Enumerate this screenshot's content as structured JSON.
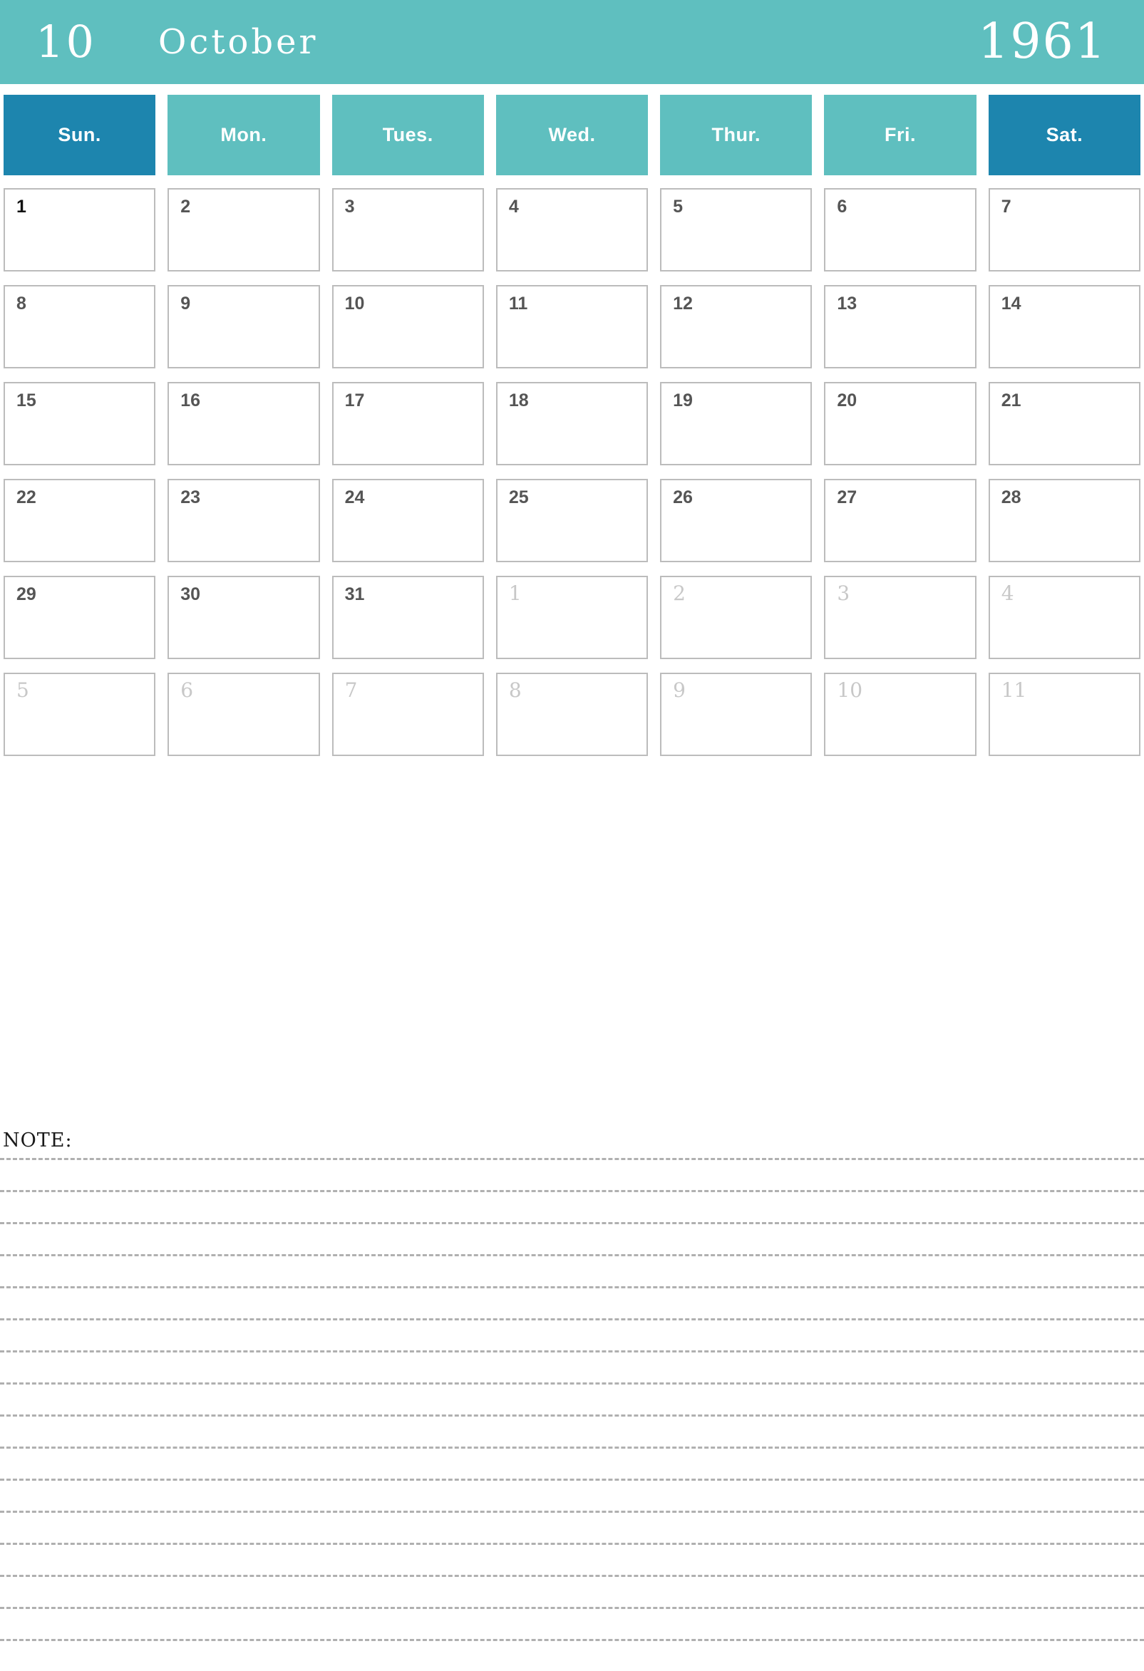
{
  "masthead": {
    "month_number": "10",
    "month_name": "October",
    "year": "1961",
    "background_color": "#5FBFBF",
    "text_color": "#FFFFFF"
  },
  "colors": {
    "teal": "#5FBFBF",
    "weekend_blue": "#1D85AE",
    "cell_border": "#BCBCBC",
    "day_text": "#555555",
    "other_month_text": "#C8C8C8",
    "note_line": "#B0B0B0"
  },
  "weekdays": [
    {
      "label": "Sun.",
      "weekend": true
    },
    {
      "label": "Mon.",
      "weekend": false
    },
    {
      "label": "Tues.",
      "weekend": false
    },
    {
      "label": "Wed.",
      "weekend": false
    },
    {
      "label": "Thur.",
      "weekend": false
    },
    {
      "label": "Fri.",
      "weekend": false
    },
    {
      "label": "Sat.",
      "weekend": true
    }
  ],
  "weeks": [
    [
      {
        "num": "1",
        "other_month": false
      },
      {
        "num": "2",
        "other_month": false
      },
      {
        "num": "3",
        "other_month": false
      },
      {
        "num": "4",
        "other_month": false
      },
      {
        "num": "5",
        "other_month": false
      },
      {
        "num": "6",
        "other_month": false
      },
      {
        "num": "7",
        "other_month": false
      }
    ],
    [
      {
        "num": "8",
        "other_month": false
      },
      {
        "num": "9",
        "other_month": false
      },
      {
        "num": "10",
        "other_month": false
      },
      {
        "num": "11",
        "other_month": false
      },
      {
        "num": "12",
        "other_month": false
      },
      {
        "num": "13",
        "other_month": false
      },
      {
        "num": "14",
        "other_month": false
      }
    ],
    [
      {
        "num": "15",
        "other_month": false
      },
      {
        "num": "16",
        "other_month": false
      },
      {
        "num": "17",
        "other_month": false
      },
      {
        "num": "18",
        "other_month": false
      },
      {
        "num": "19",
        "other_month": false
      },
      {
        "num": "20",
        "other_month": false
      },
      {
        "num": "21",
        "other_month": false
      }
    ],
    [
      {
        "num": "22",
        "other_month": false
      },
      {
        "num": "23",
        "other_month": false
      },
      {
        "num": "24",
        "other_month": false
      },
      {
        "num": "25",
        "other_month": false
      },
      {
        "num": "26",
        "other_month": false
      },
      {
        "num": "27",
        "other_month": false
      },
      {
        "num": "28",
        "other_month": false
      }
    ],
    [
      {
        "num": "29",
        "other_month": false
      },
      {
        "num": "30",
        "other_month": false
      },
      {
        "num": "31",
        "other_month": false
      },
      {
        "num": "1",
        "other_month": true
      },
      {
        "num": "2",
        "other_month": true
      },
      {
        "num": "3",
        "other_month": true
      },
      {
        "num": "4",
        "other_month": true
      }
    ],
    [
      {
        "num": "5",
        "other_month": true
      },
      {
        "num": "6",
        "other_month": true
      },
      {
        "num": "7",
        "other_month": true
      },
      {
        "num": "8",
        "other_month": true
      },
      {
        "num": "9",
        "other_month": true
      },
      {
        "num": "10",
        "other_month": true
      },
      {
        "num": "11",
        "other_month": true
      }
    ]
  ],
  "note": {
    "label": "NOTE:",
    "line_count": 16
  }
}
